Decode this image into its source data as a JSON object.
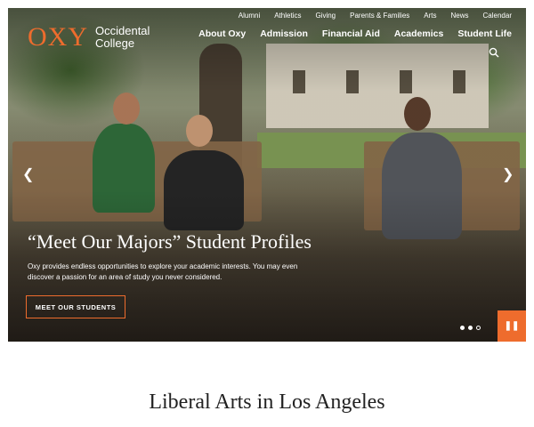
{
  "brand": {
    "logo_mark": "OXY",
    "logo_line1": "Occidental",
    "logo_line2": "College",
    "accent_color": "#ee6c2d"
  },
  "utility_nav": [
    "Alumni",
    "Athletics",
    "Giving",
    "Parents & Families",
    "Arts",
    "News",
    "Calendar"
  ],
  "main_nav": [
    "About Oxy",
    "Admission",
    "Financial Aid",
    "Academics",
    "Student Life"
  ],
  "icons": {
    "search": "search-icon",
    "prev": "chevron-left-icon",
    "next": "chevron-right-icon",
    "pause": "pause-icon"
  },
  "hero": {
    "title": "“Meet Our Majors” Student Profiles",
    "description": "Oxy provides endless opportunities to explore your academic interests. You may even discover a passion for an area of study you never considered.",
    "cta_label": "MEET OUR STUDENTS",
    "slides_total": 3,
    "active_slides": [
      1,
      2
    ]
  },
  "section": {
    "title": "Liberal Arts in Los Angeles"
  }
}
